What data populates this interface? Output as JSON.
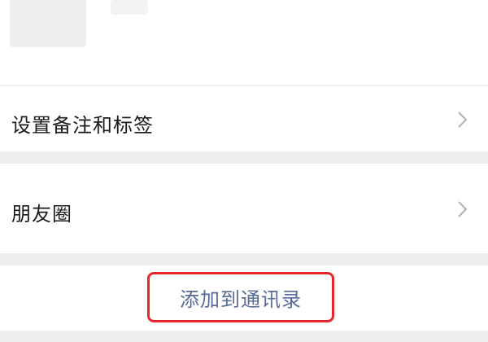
{
  "profile": {
    "avatar_icon": "avatar-placeholder"
  },
  "menu": {
    "items": [
      {
        "label": "设置备注和标签",
        "icon": "chevron-right-icon"
      },
      {
        "label": "朋友圈",
        "icon": "chevron-right-icon"
      }
    ]
  },
  "actions": {
    "add_to_contacts_label": "添加到通讯录",
    "add_to_contacts_color": "#576b95",
    "highlight_color": "#e8262a"
  }
}
